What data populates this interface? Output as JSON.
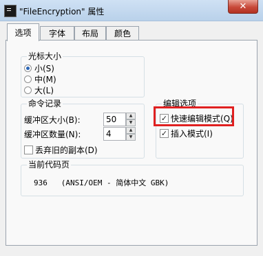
{
  "window": {
    "title": "\"FileEncryption\" 属性",
    "close_label": "✕"
  },
  "tabs": [
    {
      "label": "选项",
      "active": true
    },
    {
      "label": "字体"
    },
    {
      "label": "布局"
    },
    {
      "label": "颜色"
    }
  ],
  "cursor_size": {
    "title": "光标大小",
    "options": [
      {
        "label": "小(S)",
        "checked": true
      },
      {
        "label": "中(M)"
      },
      {
        "label": "大(L)"
      }
    ]
  },
  "command_history": {
    "title": "命令记录",
    "buffer_size_label": "缓冲区大小(B):",
    "buffer_size_value": "50",
    "buffer_count_label": "缓冲区数量(N):",
    "buffer_count_value": "4",
    "discard_old_label": "丢弃旧的副本(D)"
  },
  "edit_options": {
    "title": "编辑选项",
    "quick_edit_label": "快速编辑模式(Q)",
    "insert_mode_label": "插入模式(I)"
  },
  "code_page": {
    "title": "当前代码页",
    "value": "936   (ANSI/OEM - 简体中文 GBK)"
  },
  "icons": {
    "checkmark": "✓",
    "spin_up": "▲",
    "spin_down": "▼"
  }
}
